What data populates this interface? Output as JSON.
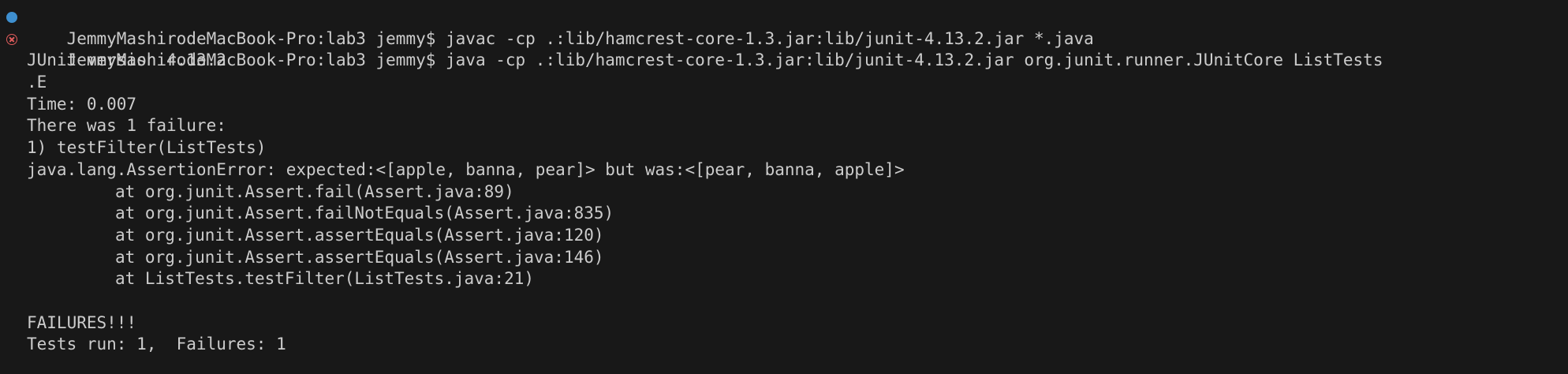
{
  "terminal": {
    "colors": {
      "background": "#181818",
      "text": "#cccccc",
      "success_marker": "#3e8fcf",
      "error_marker": "#e25d5d"
    },
    "commands": [
      {
        "status": "success",
        "marker_icon": "circle-dot-icon",
        "text": "JemmyMashirodeMacBook-Pro:lab3 jemmy$ javac -cp .:lib/hamcrest-core-1.3.jar:lib/junit-4.13.2.jar *.java"
      },
      {
        "status": "error",
        "marker_icon": "error-x-circle-icon",
        "text": "JemmyMashirodeMacBook-Pro:lab3 jemmy$ java -cp .:lib/hamcrest-core-1.3.jar:lib/junit-4.13.2.jar org.junit.runner.JUnitCore ListTests"
      }
    ],
    "output": {
      "version": "JUnit version 4.13.2",
      "progress": ".E",
      "time": "Time: 0.007",
      "failure_summary": "There was 1 failure:",
      "failure_test": "1) testFilter(ListTests)",
      "error_message": "java.lang.AssertionError: expected:<[apple, banna, pear]> but was:<[pear, banna, apple]>",
      "stack_trace": [
        "at org.junit.Assert.fail(Assert.java:89)",
        "at org.junit.Assert.failNotEquals(Assert.java:835)",
        "at org.junit.Assert.assertEquals(Assert.java:120)",
        "at org.junit.Assert.assertEquals(Assert.java:146)",
        "at ListTests.testFilter(ListTests.java:21)"
      ],
      "failures_header": "FAILURES!!!",
      "tests_summary": "Tests run: 1,  Failures: 1"
    }
  }
}
